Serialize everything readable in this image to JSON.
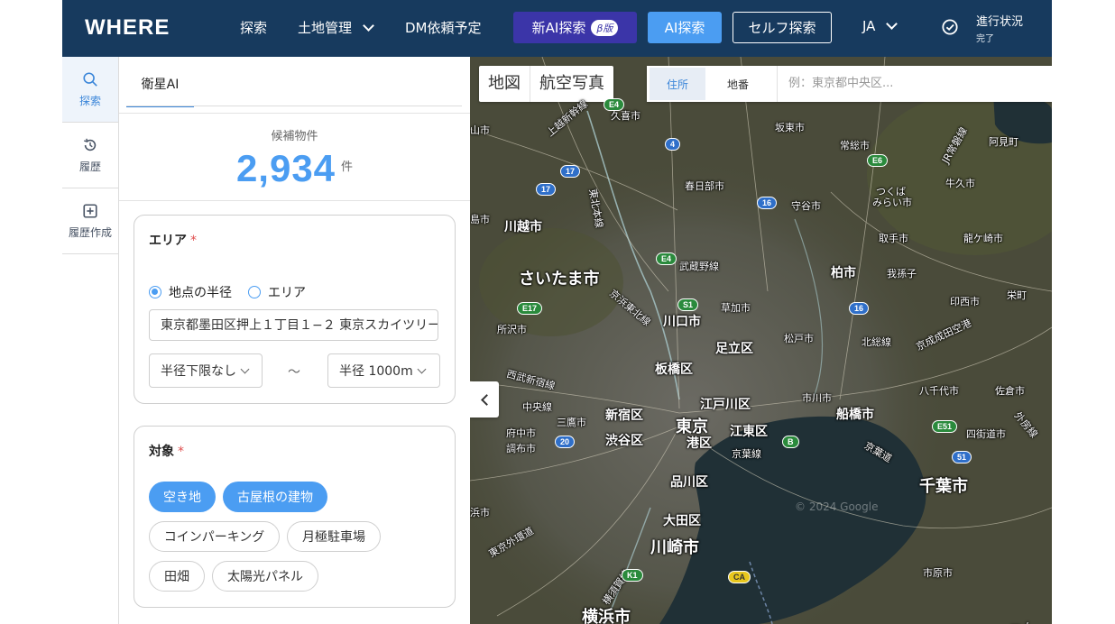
{
  "header": {
    "logo": "WHERE",
    "nav": [
      {
        "label": "探索"
      },
      {
        "label": "土地管理"
      },
      {
        "label": "DM依頼予定"
      }
    ],
    "new_ai_label": "新AI探索",
    "beta_label": "β版",
    "ai_search_label": "AI探索",
    "self_search_label": "セルフ探索",
    "lang": "JA",
    "status_title": "進行状況",
    "status_sub": "完了"
  },
  "rail": {
    "items": [
      {
        "label": "探索",
        "icon": "search-icon"
      },
      {
        "label": "履歴",
        "icon": "history-icon"
      },
      {
        "label": "履歴作成",
        "icon": "add-box-icon"
      }
    ]
  },
  "panel": {
    "tab": "衛星AI",
    "count_label": "候補物件",
    "count_value": "2,934",
    "count_unit": "件",
    "area": {
      "title": "エリア",
      "required_mark": "*",
      "radio1": "地点の半径",
      "radio2": "エリア",
      "address": "東京都墨田区押上１丁目１−２ 東京スカイツリー",
      "min_radius": "半径下限なし",
      "tilde": "〜",
      "max_radius": "半径 1000m"
    },
    "target": {
      "title": "対象",
      "required_mark": "*",
      "chips": [
        {
          "label": "空き地",
          "selected": true
        },
        {
          "label": "古屋根の建物",
          "selected": true
        },
        {
          "label": "コインパーキング",
          "selected": false
        },
        {
          "label": "月極駐車場",
          "selected": false
        },
        {
          "label": "田畑",
          "selected": false
        },
        {
          "label": "太陽光パネル",
          "selected": false
        }
      ]
    }
  },
  "map": {
    "type_map": "地図",
    "type_aerial": "航空写真",
    "seg_address": "住所",
    "seg_lot": "地番",
    "search_placeholder": "例：東京都中央区...",
    "watermark": "© 2024 Google",
    "labels": {
      "l01": "久喜市",
      "l02": "坂東市",
      "l03": "阿見町",
      "l04": "常総市",
      "l05": "牛久市",
      "l06": "春日部市",
      "l07": "守谷市",
      "l08": "つくば",
      "l09": "みらい市",
      "l10": "川越市",
      "l11": "取手市",
      "l12": "龍ケ崎市",
      "l13": "武蔵野線",
      "l14": "さいたま市",
      "l15": "柏市",
      "l16": "我孫子",
      "l17": "草加市",
      "l18": "印西市",
      "l19": "栄町",
      "l20": "川口市",
      "l21": "所沢市",
      "l22": "足立区",
      "l23": "松戸市",
      "l24": "北総線",
      "l25": "京成成田空港",
      "l26": "板橋区",
      "l27": "西武新宿線",
      "l28": "市川市",
      "l29": "八千代市",
      "l30": "佐倉市",
      "l31": "中央線",
      "l32": "江戸川区",
      "l33": "新宿区",
      "l34": "府中市",
      "l35": "三鷹市",
      "l36": "東京",
      "l37": "江東区",
      "l38": "船橋市",
      "l39": "四街道市",
      "l40": "調布市",
      "l41": "渋谷区",
      "l42": "港区",
      "l43": "京葉線",
      "l44": "京葉道",
      "l45": "千葉市",
      "l46": "品川区",
      "l47": "大田区",
      "l48": "川崎市",
      "l49": "市原市",
      "l50": "横浜市",
      "l51": "上越新幹線",
      "l52": "東北本線",
      "l53": "JR常磐線",
      "l54": "横須賀線",
      "l55": "京浜東北線",
      "l56": "東京外環道",
      "l57": "外房線",
      "l58": "山市",
      "l59": "島市",
      "l60": "一ノ",
      "l61": "浜市"
    },
    "shields": {
      "s1": "E4",
      "s2": "4",
      "s3": "17",
      "s4": "17",
      "s5": "E6",
      "s6": "16",
      "s7": "E4",
      "s8": "S1",
      "s9": "E17",
      "s10": "16",
      "s11": "20",
      "s12": "E51",
      "s13": "51",
      "s14": "B",
      "s15": "K1",
      "s16": "CA"
    },
    "colors": {
      "land": "#4a4b3a",
      "water": "#203036"
    }
  }
}
